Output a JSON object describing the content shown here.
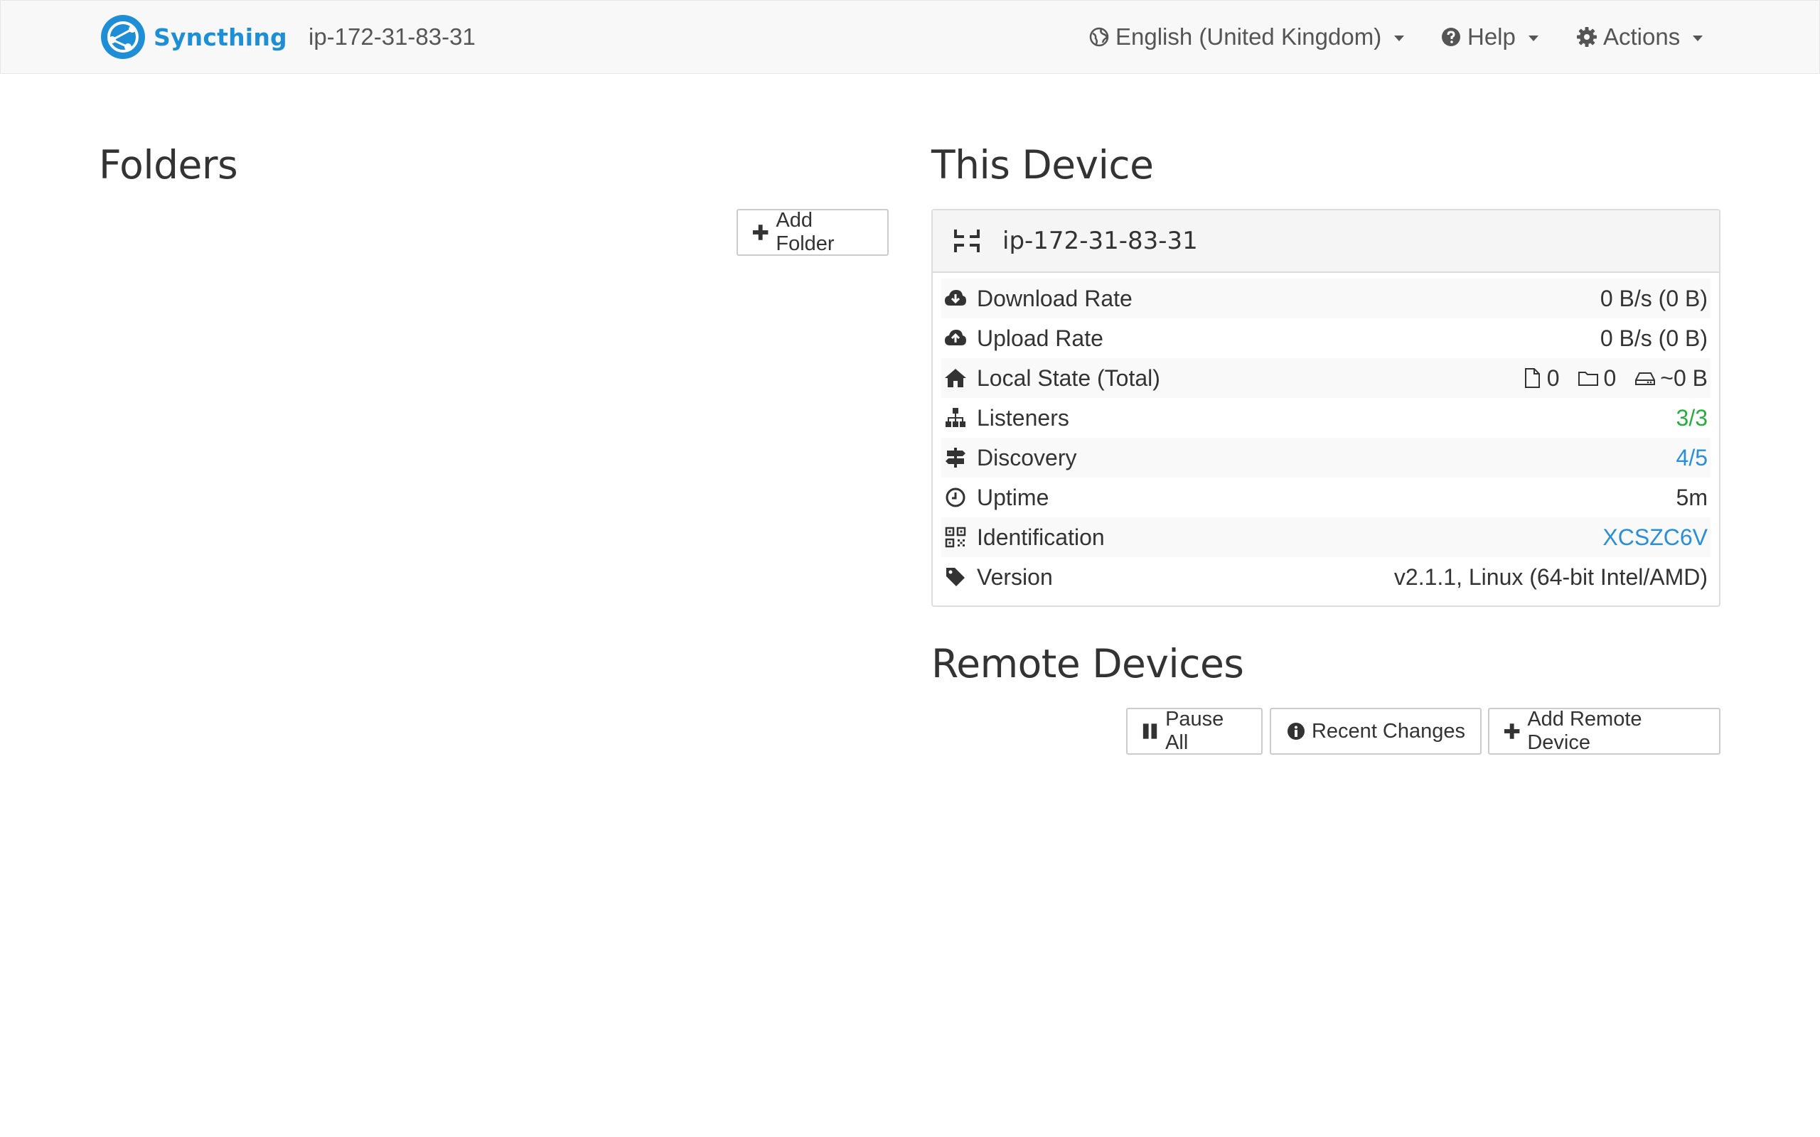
{
  "nav": {
    "brand": "Syncthing",
    "device_name": "ip-172-31-83-31",
    "language": "English (United Kingdom)",
    "help": "Help",
    "actions": "Actions"
  },
  "folders": {
    "heading": "Folders",
    "add_button": "Add Folder"
  },
  "this_device": {
    "heading": "This Device",
    "name": "ip-172-31-83-31",
    "rows": [
      {
        "label": "Download Rate",
        "value": "0 B/s (0 B)",
        "icon": "cloud-download-icon"
      },
      {
        "label": "Upload Rate",
        "value": "0 B/s (0 B)",
        "icon": "cloud-upload-icon"
      },
      {
        "label": "Local State (Total)",
        "files": "0",
        "dirs": "0",
        "size": "~0 B",
        "icon": "home-icon"
      },
      {
        "label": "Listeners",
        "value": "3/3",
        "icon": "sitemap-icon",
        "color": "#27ae3f"
      },
      {
        "label": "Discovery",
        "value": "4/5",
        "icon": "signpost-icon",
        "color": "#2a8fd8"
      },
      {
        "label": "Uptime",
        "value": "5m",
        "icon": "clock-icon"
      },
      {
        "label": "Identification",
        "value": "XCSZC6V",
        "icon": "qrcode-icon",
        "color": "#2a8fd8"
      },
      {
        "label": "Version",
        "value": "v2.1.1, Linux (64-bit Intel/AMD)",
        "icon": "tag-icon"
      }
    ]
  },
  "remote_devices": {
    "heading": "Remote Devices",
    "pause_all": "Pause All",
    "recent_changes": "Recent Changes",
    "add_remote": "Add Remote Device"
  }
}
